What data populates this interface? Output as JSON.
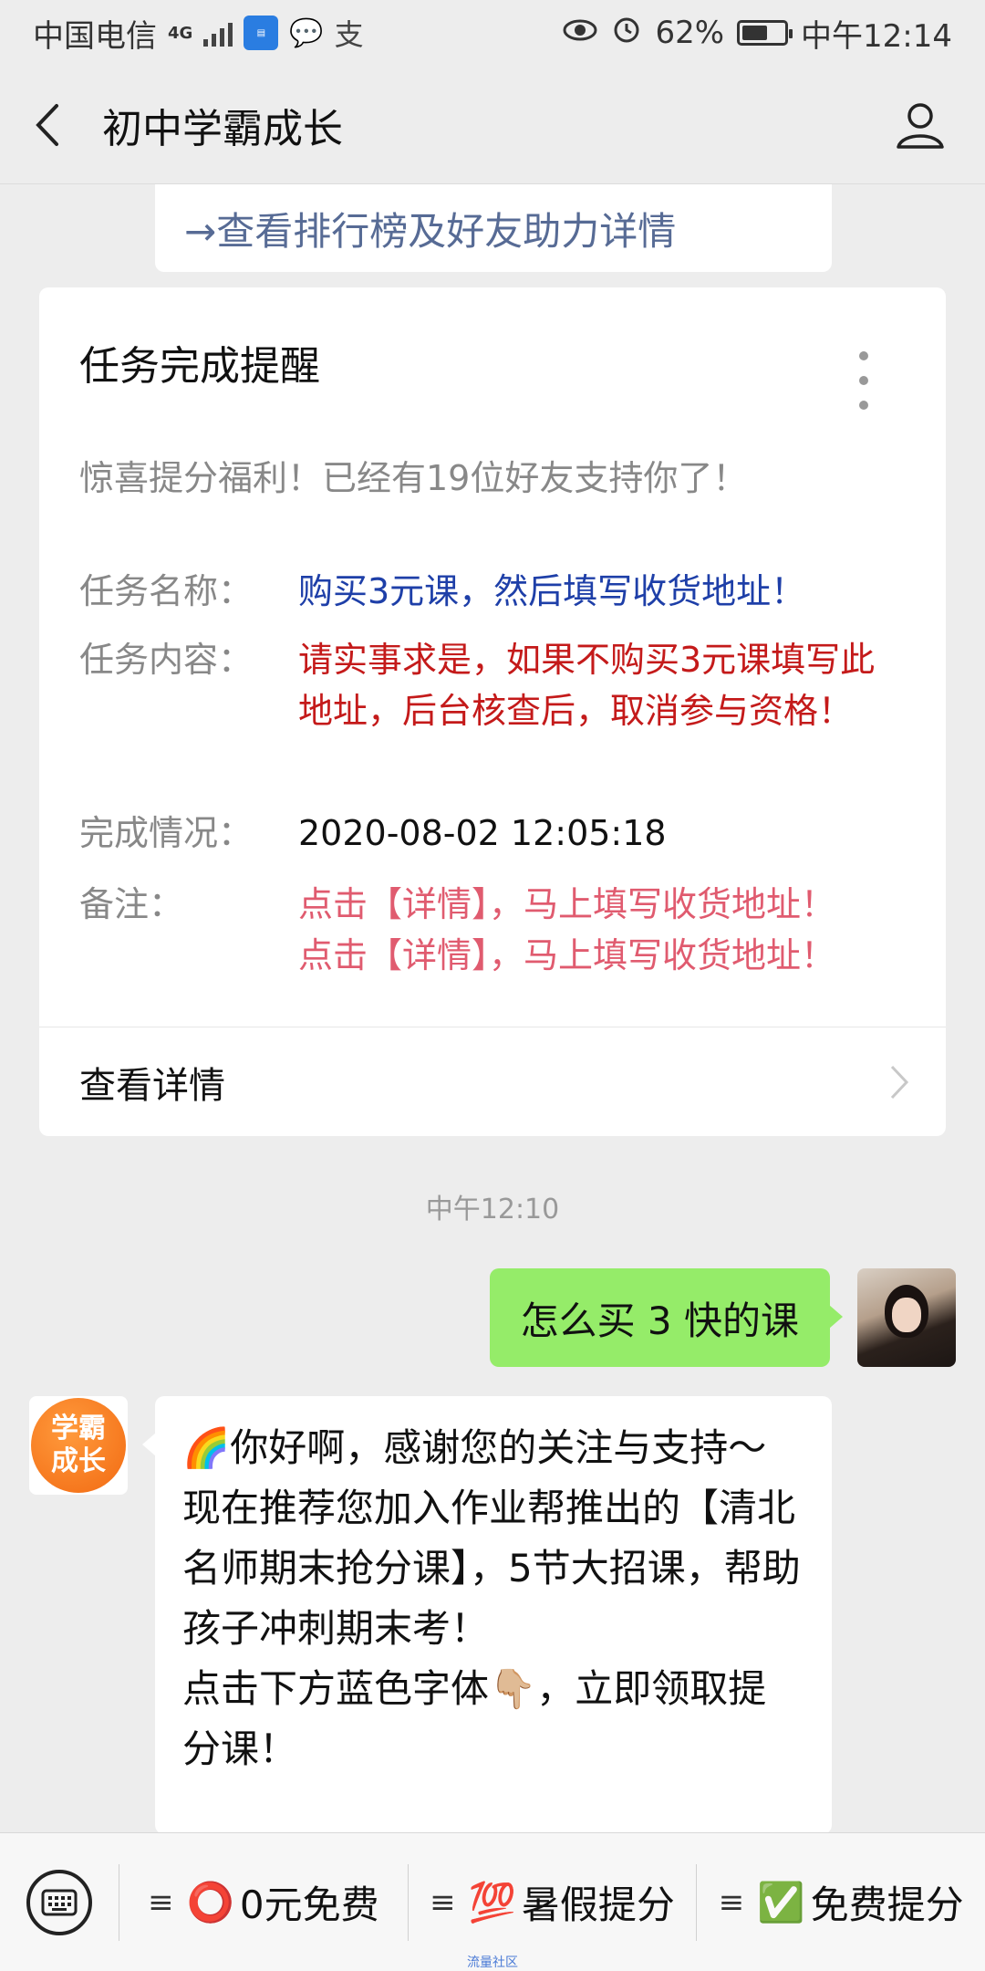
{
  "status_bar": {
    "carrier": "中国电信",
    "network": "4G",
    "battery": "62%",
    "battery_level": 0.62,
    "time": "中午12:14"
  },
  "nav": {
    "title": "初中学霸成长"
  },
  "top_card": {
    "link_text": "→查看排行榜及好友助力详情"
  },
  "task_card": {
    "title": "任务完成提醒",
    "intro": "惊喜提分福利！已经有19位好友支持你了！",
    "rows": [
      {
        "label": "任务名称：",
        "value": "购买3元课，然后填写收货地址！"
      },
      {
        "label": "任务内容：",
        "value": "请实事求是，如果不购买3元课填写此地址，后台核查后，取消参与资格！"
      },
      {
        "label": "完成情况：",
        "value": "2020-08-02 12:05:18"
      },
      {
        "label": "备注：",
        "value": "点击【详情】，马上填写收货地址！\n点击【详情】，马上填写收货地址！"
      }
    ],
    "footer": "查看详情"
  },
  "timestamp": "中午12:10",
  "messages": {
    "outgoing": "怎么买 3 快的课",
    "bot_avatar_text": "学霸成长",
    "incoming": "🌈你好啊，感谢您的关注与支持～\n现在推荐您加入作业帮推出的【清北名师期末抢分课】，5节大招课，帮助孩子冲刺期末考！\n点击下方蓝色字体👇🏼，立即领取提分课！"
  },
  "bottom_menu": {
    "items": [
      {
        "icon": "⭕",
        "label": "0元免费"
      },
      {
        "icon": "💯",
        "label": "暑假提分"
      },
      {
        "icon": "✅",
        "label": "免费提分"
      }
    ]
  },
  "watermark": "流量社区"
}
